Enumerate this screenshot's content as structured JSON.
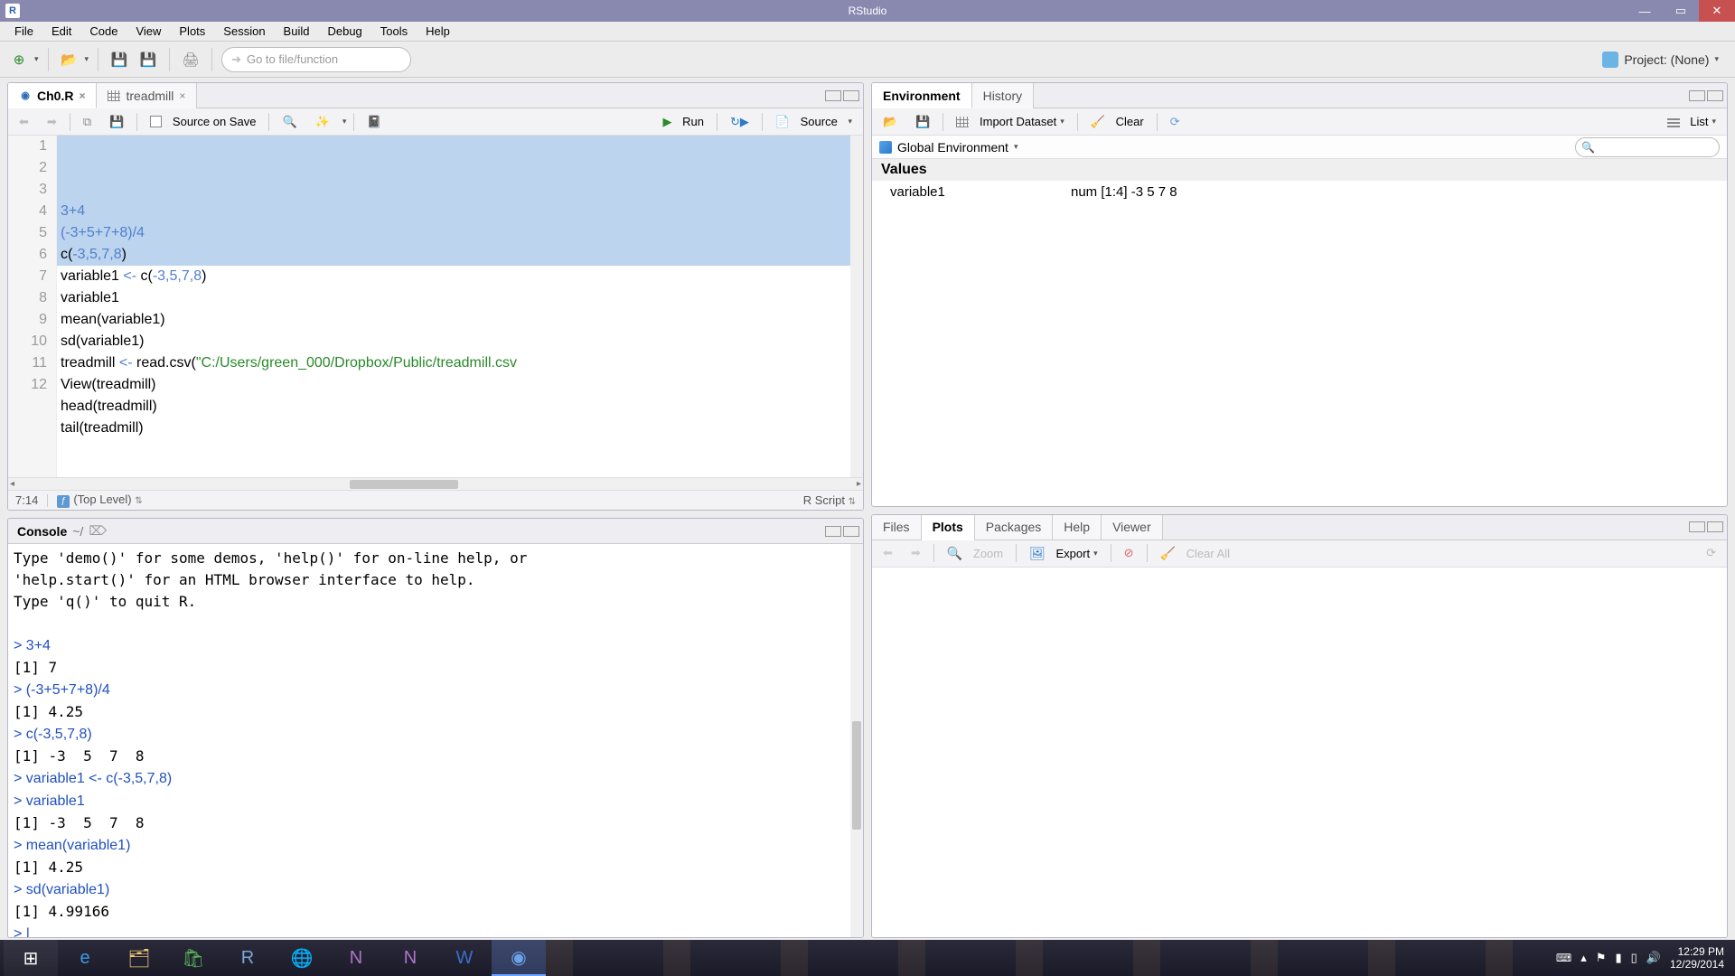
{
  "title": "RStudio",
  "menubar": [
    "File",
    "Edit",
    "Code",
    "View",
    "Plots",
    "Session",
    "Build",
    "Debug",
    "Tools",
    "Help"
  ],
  "toolbar": {
    "gotofile_placeholder": "Go to file/function",
    "project_label": "Project: (None)"
  },
  "source": {
    "tabs": [
      {
        "label": "Ch0.R",
        "active": true
      },
      {
        "label": "treadmill",
        "active": false
      }
    ],
    "source_on_save": "Source on Save",
    "run": "Run",
    "source_btn": "Source",
    "cursor_pos": "7:14",
    "scope": "(Top Level)",
    "filetype": "R Script",
    "lines": [
      {
        "n": 1,
        "raw": "3+4",
        "css": "hl-num"
      },
      {
        "n": 2,
        "raw": "(-3+5+7+8)/4",
        "css": "hl-num"
      },
      {
        "n": 3,
        "raw": "c(-3,5,7,8)",
        "html": "c(<span class='hl-num'>-3,5,7,8</span>)"
      },
      {
        "n": 4,
        "html": "variable1 <span class='hl-op'>&lt;-</span> c(<span class='hl-num'>-3,5,7,8</span>)"
      },
      {
        "n": 5,
        "raw": "variable1"
      },
      {
        "n": 6,
        "raw": "mean(variable1)"
      },
      {
        "n": 7,
        "raw": "sd(variable1)"
      },
      {
        "n": 8,
        "html": "treadmill <span class='hl-op'>&lt;-</span> read.csv(<span class='hl-str'>\"C:/Users/green_000/Dropbox/Public/treadmill.csv</span>"
      },
      {
        "n": 9,
        "raw": "View(treadmill)"
      },
      {
        "n": 10,
        "raw": "head(treadmill)"
      },
      {
        "n": 11,
        "raw": "tail(treadmill)"
      },
      {
        "n": 12,
        "raw": ""
      }
    ],
    "selection_lines": [
      1,
      6
    ]
  },
  "console": {
    "tab": "Console",
    "path": "~/",
    "lines": [
      {
        "t": "Type 'demo()' for some demos, 'help()' for on-line help, or"
      },
      {
        "t": "'help.start()' for an HTML browser interface to help."
      },
      {
        "t": "Type 'q()' to quit R."
      },
      {
        "t": ""
      },
      {
        "t": "> 3+4",
        "blue": true
      },
      {
        "t": "[1] 7"
      },
      {
        "t": "> (-3+5+7+8)/4",
        "blue": true
      },
      {
        "t": "[1] 4.25"
      },
      {
        "t": "> c(-3,5,7,8)",
        "blue": true
      },
      {
        "t": "[1] -3  5  7  8"
      },
      {
        "t": "> variable1 <- c(-3,5,7,8)",
        "blue": true
      },
      {
        "t": "> variable1",
        "blue": true
      },
      {
        "t": "[1] -3  5  7  8"
      },
      {
        "t": "> mean(variable1)",
        "blue": true
      },
      {
        "t": "[1] 4.25"
      },
      {
        "t": "> sd(variable1)",
        "blue": true
      },
      {
        "t": "[1] 4.99166"
      },
      {
        "t": "> |",
        "blue": true
      }
    ]
  },
  "environment": {
    "tabs": [
      "Environment",
      "History"
    ],
    "import": "Import Dataset",
    "clear": "Clear",
    "globalenv": "Global Environment",
    "list": "List",
    "section": "Values",
    "rows": [
      {
        "name": "variable1",
        "value": "num [1:4] -3 5 7 8"
      }
    ]
  },
  "plots": {
    "tabs": [
      "Files",
      "Plots",
      "Packages",
      "Help",
      "Viewer"
    ],
    "active_tab": "Plots",
    "zoom": "Zoom",
    "export": "Export",
    "clearall": "Clear All"
  },
  "tray": {
    "time": "12:29 PM",
    "date": "12/29/2014"
  }
}
